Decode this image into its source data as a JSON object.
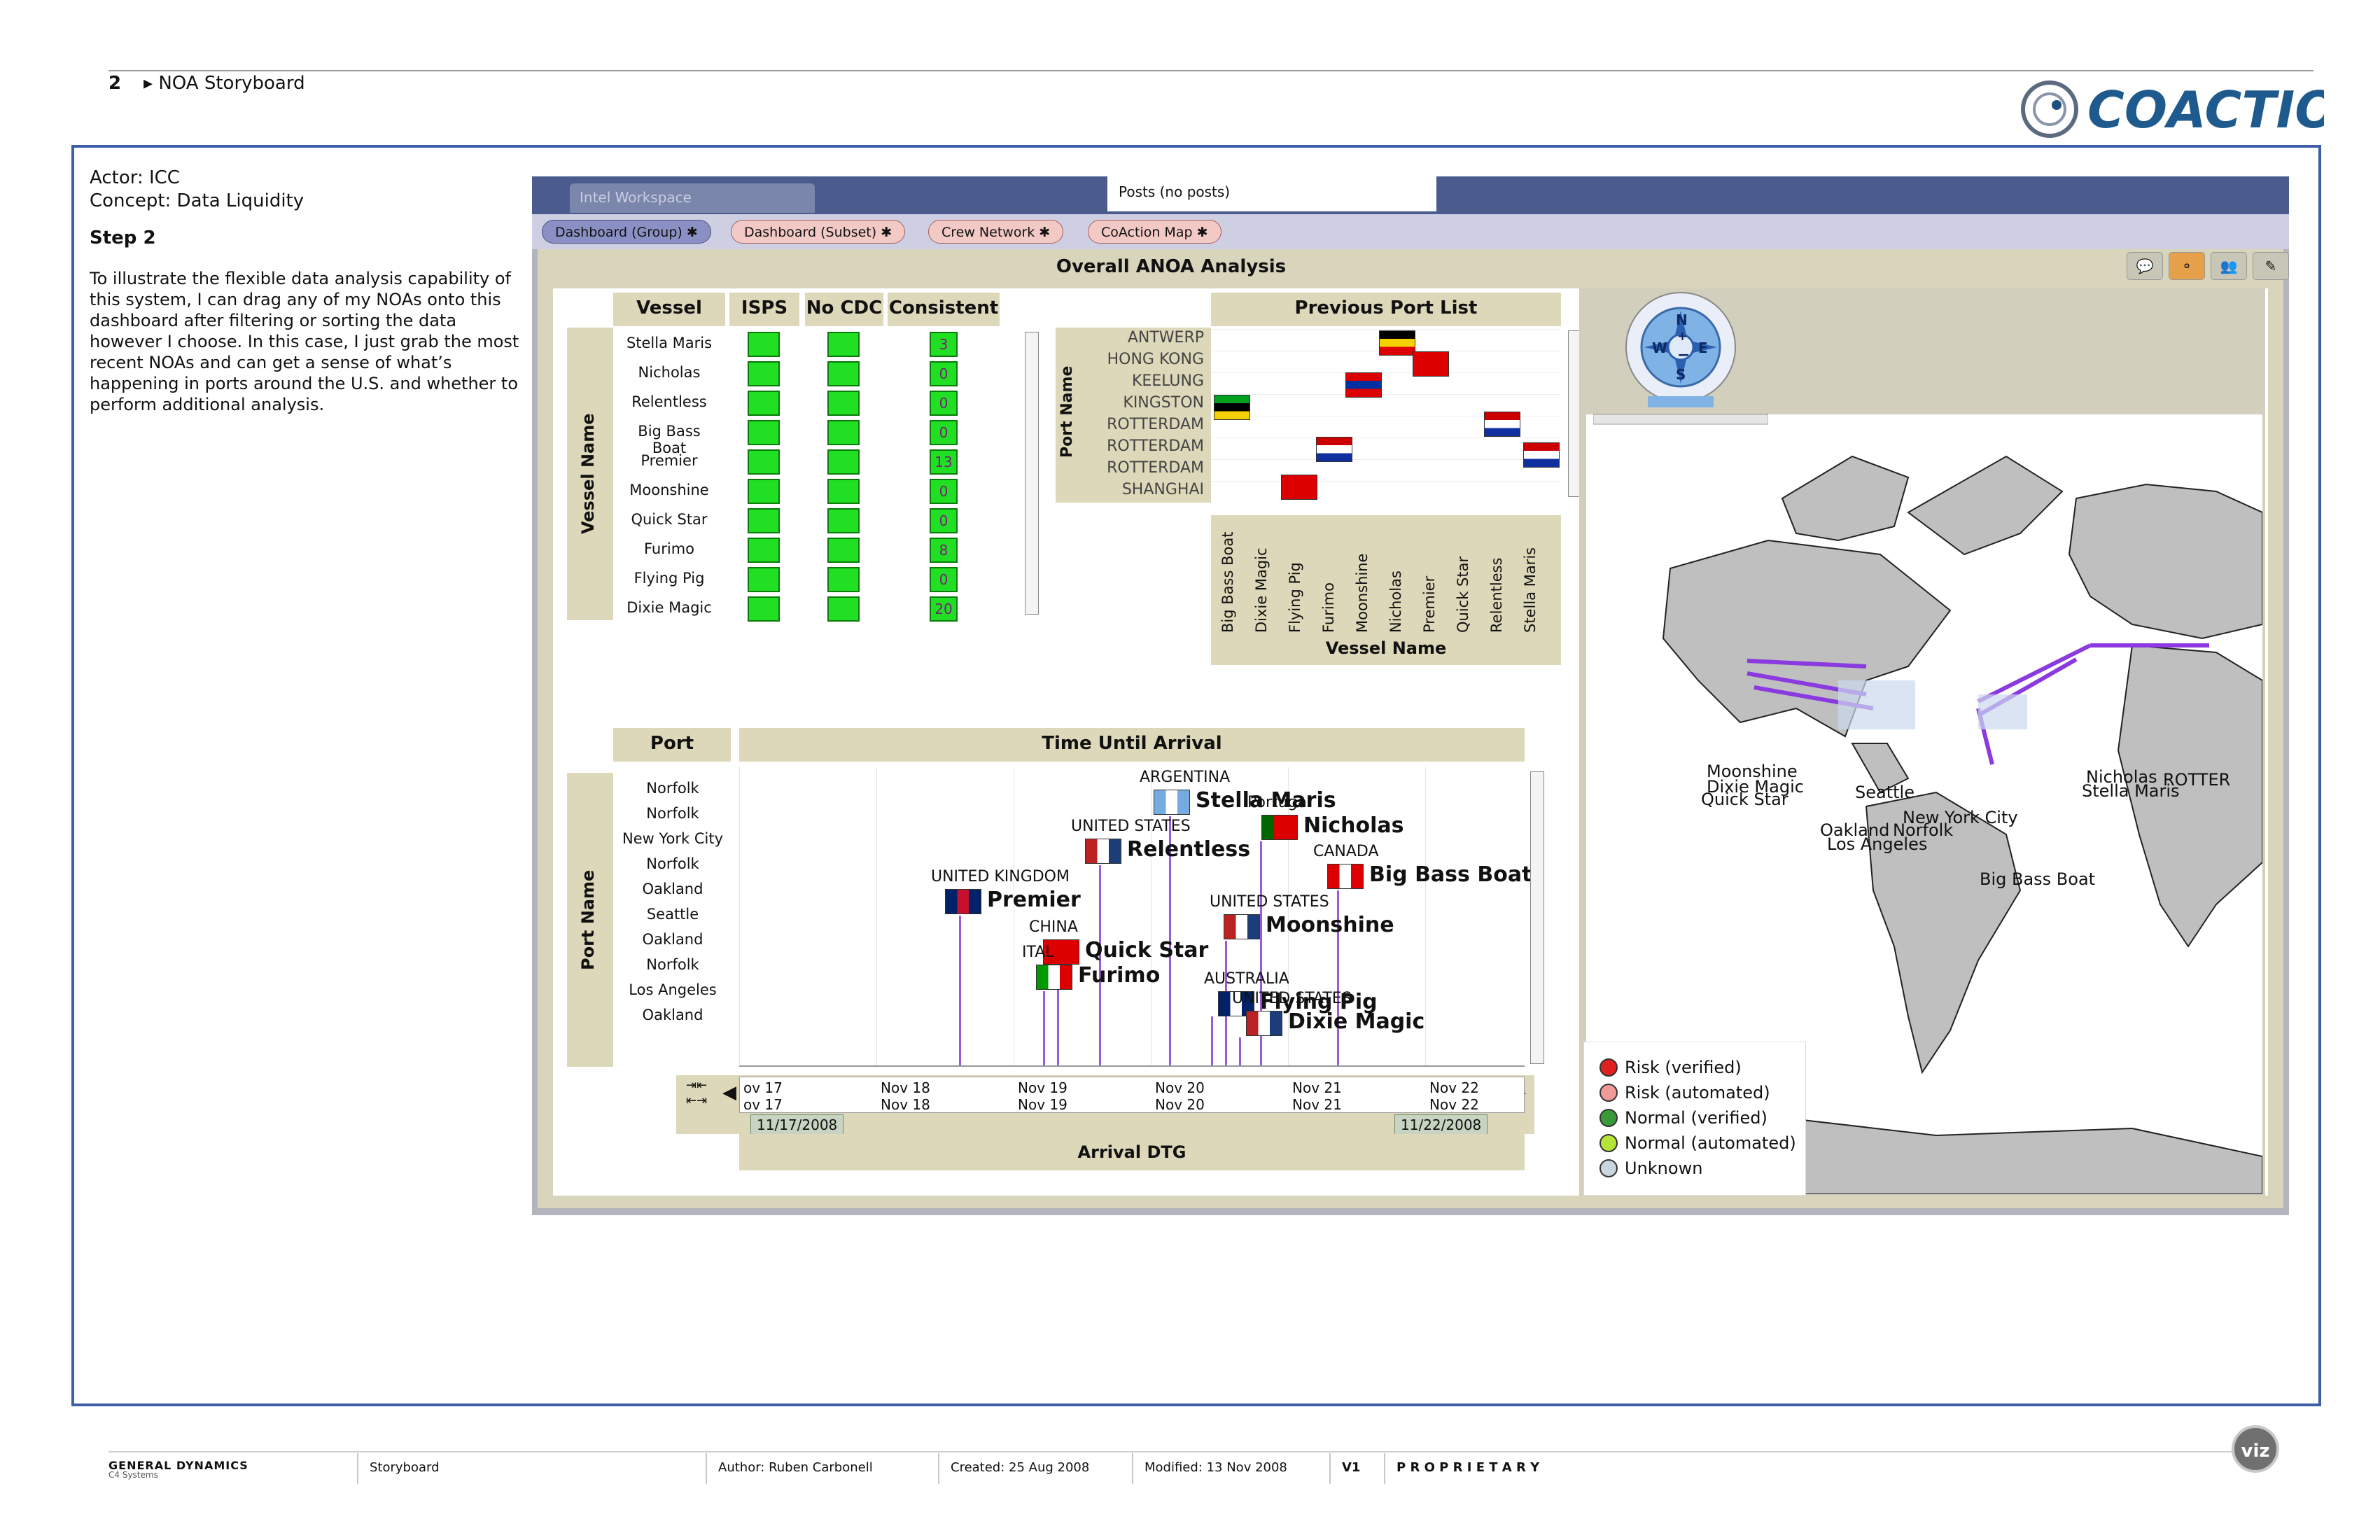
{
  "page": {
    "number": "2",
    "section": "NOA Storyboard",
    "logo_text": "COACTION"
  },
  "left": {
    "actor": "Actor: ICC",
    "concept": "Concept: Data Liquidity",
    "step": "Step 2",
    "description": "To illustrate the flexible data analysis capability of this system, I can drag any of my NOAs onto this dashboard after filtering or sorting the data however I choose. In this case, I just grab the most recent NOAs and can get a sense of what’s happening in ports around the U.S. and whether to perform additional analysis."
  },
  "app": {
    "workspace_label": "Intel Workspace",
    "posts_label": "Posts (no posts)",
    "tabs": [
      "Dashboard (Group)",
      "Dashboard (Subset)",
      "Crew Network",
      "CoAction Map"
    ],
    "panel_title": "Overall ANOA Analysis"
  },
  "vessel_table": {
    "headers": [
      "Vessel",
      "ISPS",
      "No CDC",
      "Consistent"
    ],
    "axis_label": "Vessel Name",
    "rows": [
      {
        "vessel": "Stella Maris",
        "consistent": "3"
      },
      {
        "vessel": "Nicholas",
        "consistent": "0"
      },
      {
        "vessel": "Relentless",
        "consistent": "0"
      },
      {
        "vessel": "Big Bass Boat",
        "consistent": "0"
      },
      {
        "vessel": "Premier",
        "consistent": "13"
      },
      {
        "vessel": "Moonshine",
        "consistent": "0"
      },
      {
        "vessel": "Quick Star",
        "consistent": "0"
      },
      {
        "vessel": "Furimo",
        "consistent": "8"
      },
      {
        "vessel": "Flying Pig",
        "consistent": "0"
      },
      {
        "vessel": "Dixie Magic",
        "consistent": "20"
      }
    ]
  },
  "port_list": {
    "title": "Previous Port List",
    "y_label": "Port Name",
    "x_label": "Vessel Name",
    "ports": [
      "ANTWERP",
      "HONG KONG",
      "KEELUNG",
      "KINGSTON",
      "ROTTERDAM",
      "ROTTERDAM",
      "ROTTERDAM",
      "SHANGHAI"
    ],
    "vessels": [
      "Big Bass Boat",
      "Dixie Magic",
      "Flying Pig",
      "Furimo",
      "Moonshine",
      "Nicholas",
      "Premier",
      "Quick Star",
      "Relentless",
      "Stella Maris"
    ]
  },
  "timeline": {
    "port_header": "Port",
    "time_header": "Time Until Arrival",
    "axis_label": "Port Name",
    "ports": [
      "Norfolk",
      "Norfolk",
      "New York City",
      "Norfolk",
      "Oakland",
      "Seattle",
      "Oakland",
      "Norfolk",
      "Los Angeles",
      "Oakland"
    ],
    "arrivals": [
      {
        "vessel": "Stella Maris",
        "country": "ARGENTINA"
      },
      {
        "vessel": "Nicholas",
        "country": "Portugal"
      },
      {
        "vessel": "Relentless",
        "country": "UNITED STATES"
      },
      {
        "vessel": "Big Bass Boat",
        "country": "CANADA"
      },
      {
        "vessel": "Premier",
        "country": "UNITED KINGDOM"
      },
      {
        "vessel": "Moonshine",
        "country": "UNITED STATES"
      },
      {
        "vessel": "Quick Star",
        "country": "CHINA"
      },
      {
        "vessel": "Furimo",
        "country": "ITAL"
      },
      {
        "vessel": "Flying Pig",
        "country": "AUSTRALIA"
      },
      {
        "vessel": "Dixie Magic",
        "country": "UNITED STATES"
      }
    ],
    "dates_row1": [
      "ov 17",
      "Nov 18",
      "Nov 19",
      "Nov 20",
      "Nov 21",
      "Nov 22"
    ],
    "dates_row2": [
      "ov 17",
      "Nov 18",
      "Nov 19",
      "Nov 20",
      "Nov 21",
      "Nov 22"
    ],
    "range_start": "11/17/2008",
    "range_end": "11/22/2008",
    "x_label": "Arrival DTG"
  },
  "map": {
    "compass": [
      "N",
      "E",
      "S",
      "W"
    ],
    "labels": [
      "Moonshine",
      "Dixie Magic",
      "Quick Star",
      "Seattle",
      "Oakland",
      "Los Angeles",
      "New York City",
      "Norfolk",
      "Nicholas",
      "Stella Maris",
      "ROTTER",
      "Big Bass Boat"
    ],
    "legend": [
      {
        "label": "Risk (verified)",
        "color": "#e02020"
      },
      {
        "label": "Risk (automated)",
        "color": "#f29a9a"
      },
      {
        "label": "Normal (verified)",
        "color": "#3a9a3a"
      },
      {
        "label": "Normal (automated)",
        "color": "#b6e436"
      },
      {
        "label": "Unknown",
        "color": "#c9d6dd"
      }
    ]
  },
  "footer": {
    "company": "GENERAL DYNAMICS",
    "division": "C4 Systems",
    "doc_type": "Storyboard",
    "author": "Author: Ruben Carbonell",
    "created": "Created: 25 Aug 2008",
    "modified": "Modified: 13 Nov 2008",
    "version": "V1",
    "classification": "P R O P R I E T A R Y",
    "badge": "viz"
  }
}
